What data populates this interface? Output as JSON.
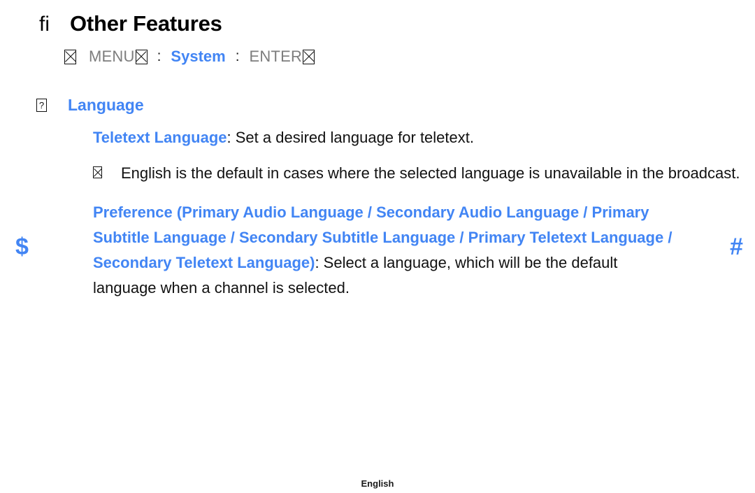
{
  "page": {
    "title_ligature_glyph": "fi",
    "title": "Other Features",
    "footer_label": "English",
    "accent_color": "#4285f4",
    "text_color": "#111111",
    "muted_color": "#7d7d7d",
    "background": "#ffffff"
  },
  "menu_path": {
    "lead_icon": "missing-glyph-box",
    "menu_label": "MENU",
    "menu_icon": "missing-glyph-box",
    "separator_1": ":",
    "system_label": "System",
    "separator_2": ":",
    "enter_label": "ENTER",
    "enter_icon": "missing-glyph-box"
  },
  "section": {
    "icon": "?",
    "heading": "Language"
  },
  "items": {
    "teletext": {
      "term": "Teletext Language",
      "description": ": Set a desired language for teletext."
    },
    "note": {
      "bullet_icon": "missing-glyph-box",
      "text": "English is the default in cases where the selected language is unavailable in the broadcast."
    },
    "preference": {
      "term": "Preference (Primary Audio Language / Secondary Audio Language / Primary Subtitle Language / Secondary Subtitle Language / Primary Teletext Language / Secondary Teletext Language)",
      "description": ": Select a language, which will be the default language when a channel is selected."
    }
  },
  "navigation": {
    "left_marker": "$",
    "right_marker": "#"
  }
}
